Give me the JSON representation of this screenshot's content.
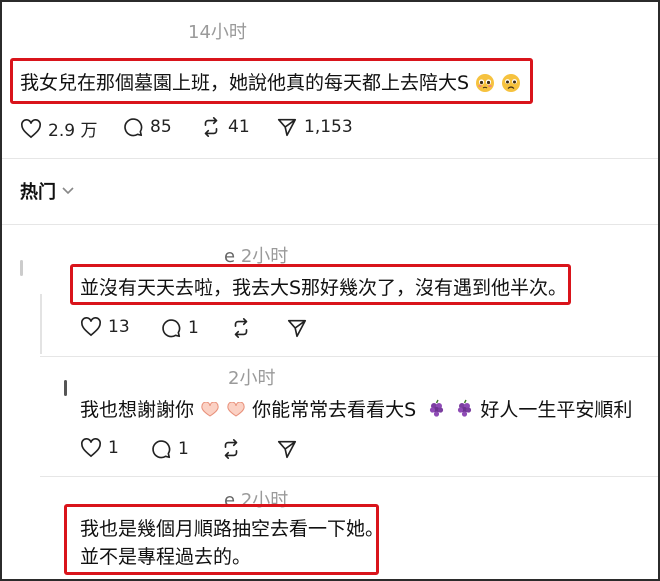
{
  "post": {
    "time": "14小时",
    "text": "我女兒在那個墓園上班，她說他真的每天都上去陪大S",
    "likes": "2.9 万",
    "replies": "85",
    "reposts": "41",
    "shares": "1,153"
  },
  "section": {
    "title": "热门"
  },
  "comments": [
    {
      "time": "2小时",
      "prefix": "e",
      "text": "並沒有天天去啦，我去大S那好幾次了，沒有遇到他半次。",
      "likes": "13",
      "replies": "1"
    },
    {
      "time": "2小时",
      "text_a": "我也想謝謝你",
      "text_b": "你能常常去看看大S",
      "text_c": "好人一生平安順利",
      "likes": "1",
      "replies": "1"
    },
    {
      "time": "2小时",
      "prefix": "e",
      "line1": "我也是幾個月順路抽空去看一下她。",
      "line2": "並不是專程過去的。"
    }
  ],
  "colors": {
    "highlight": "#d9141b",
    "muted": "#9a9a9a"
  }
}
